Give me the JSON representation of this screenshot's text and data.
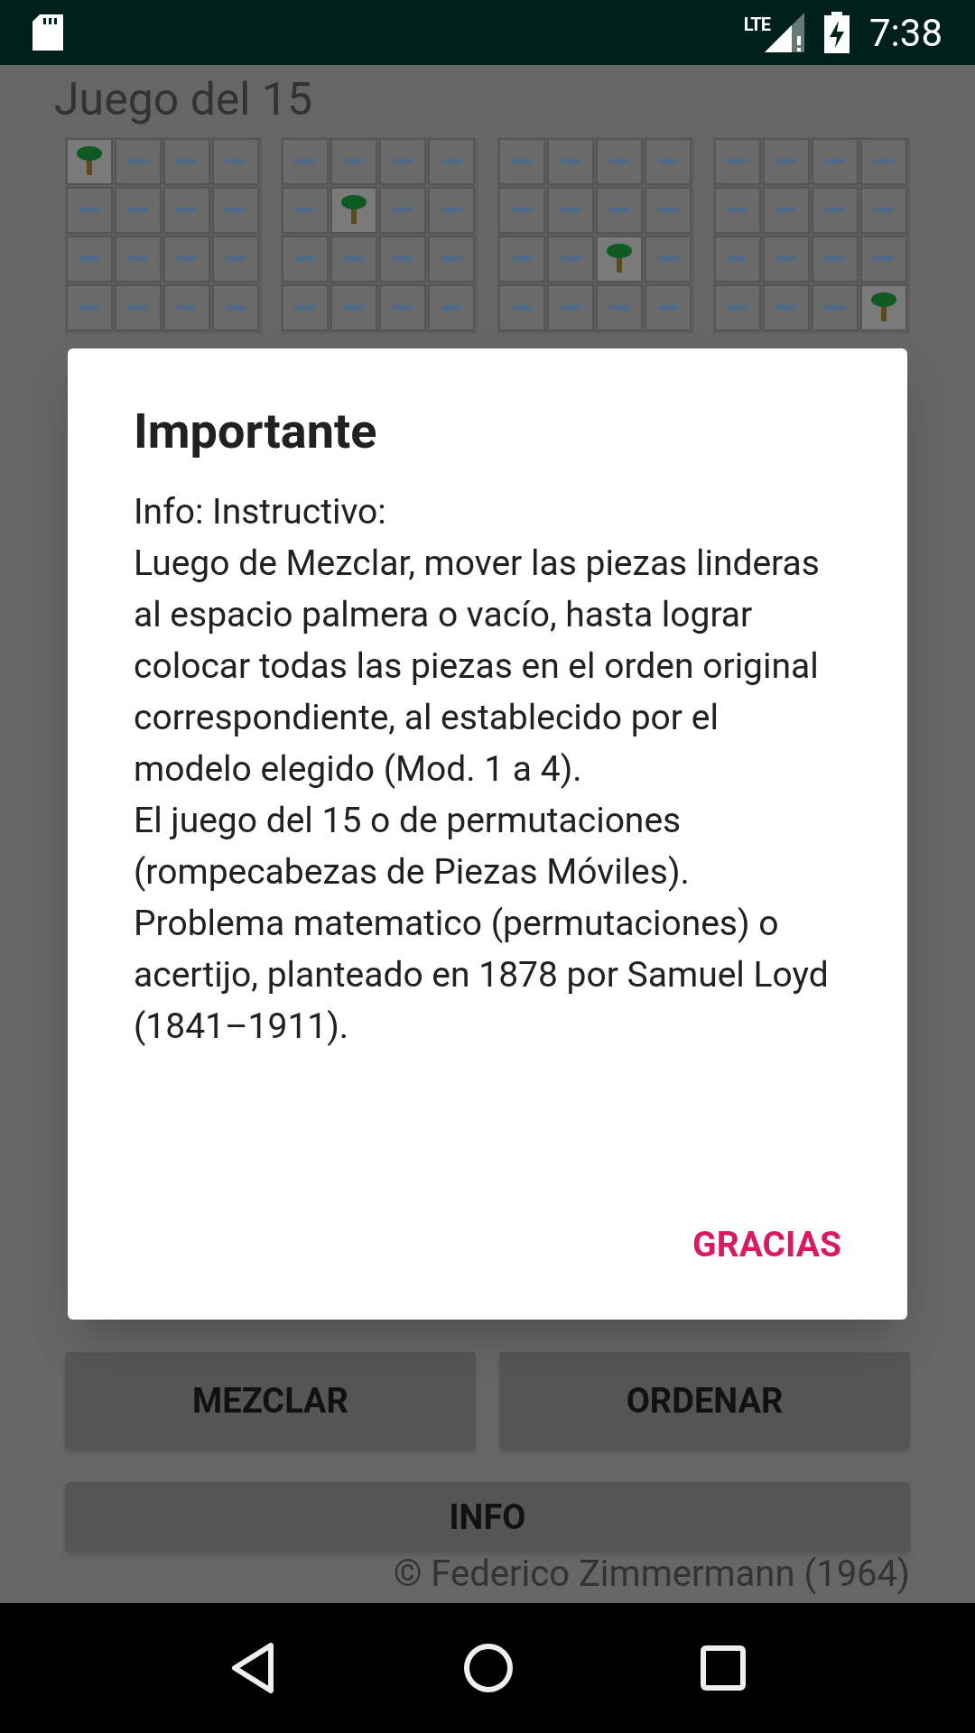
{
  "status_bar": {
    "network": "LTE",
    "time": "7:38"
  },
  "app": {
    "title": "Juego del 15",
    "buttons": [
      "MEZCLAR",
      "ORDENAR"
    ],
    "info_button": "INFO",
    "copyright": "© Federico Zimmermann (1964)"
  },
  "dialog": {
    "title": "Importante",
    "body": "Info: Instructivo:\nLuego de Mezclar, mover las piezas linderas al espacio palmera o vacío, hasta lograr colocar todas las piezas en el orden original correspondiente, al establecido por el modelo elegido (Mod. 1 a 4).\nEl juego del 15 o de permutaciones (rompecabezas de Piezas Móviles).\nProblema matematico (permutaciones) o acertijo, planteado en 1878 por Samuel Loyd (1841–1911).",
    "action": "GRACIAS"
  }
}
